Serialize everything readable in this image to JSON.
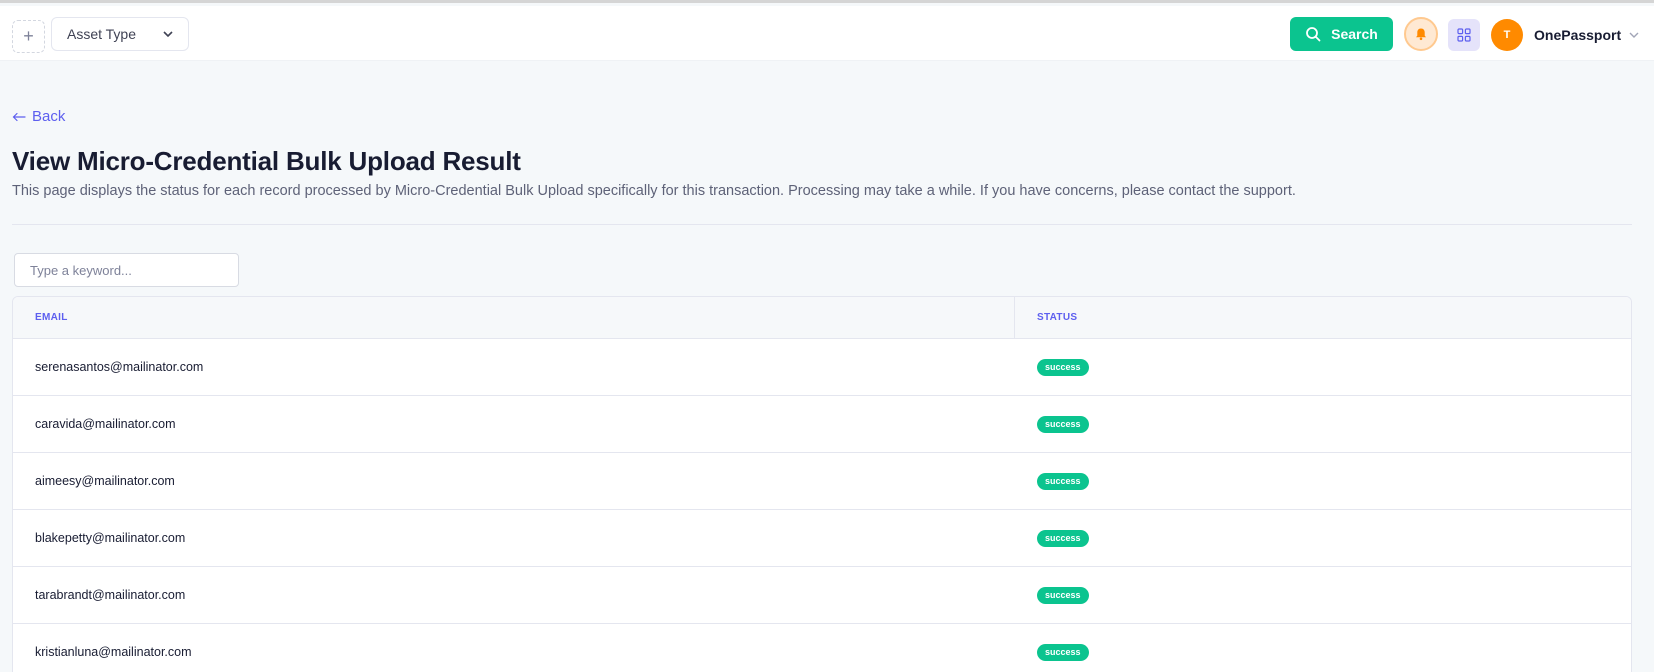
{
  "header": {
    "add_icon": "plus-icon",
    "asset_type_label": "Asset Type",
    "search_label": "Search",
    "user_initial": "T",
    "user_name": "OnePassport",
    "colors": {
      "primary": "#0bc48f",
      "accent": "#5d5fef",
      "avatar": "#ff8a00"
    }
  },
  "content": {
    "back_label": "Back",
    "title": "View Micro-Credential Bulk Upload Result",
    "description": "This page displays the status for each record processed by Micro-Credential Bulk Upload specifically for this transaction. Processing may take a while. If you have concerns, please contact the support.",
    "search_placeholder": "Type a keyword..."
  },
  "table": {
    "columns": [
      "EMAIL",
      "STATUS"
    ],
    "rows": [
      {
        "email": "serenasantos@mailinator.com",
        "status": "success"
      },
      {
        "email": "caravida@mailinator.com",
        "status": "success"
      },
      {
        "email": "aimeesy@mailinator.com",
        "status": "success"
      },
      {
        "email": "blakepetty@mailinator.com",
        "status": "success"
      },
      {
        "email": "tarabrandt@mailinator.com",
        "status": "success"
      },
      {
        "email": "kristianluna@mailinator.com",
        "status": "success"
      }
    ]
  }
}
